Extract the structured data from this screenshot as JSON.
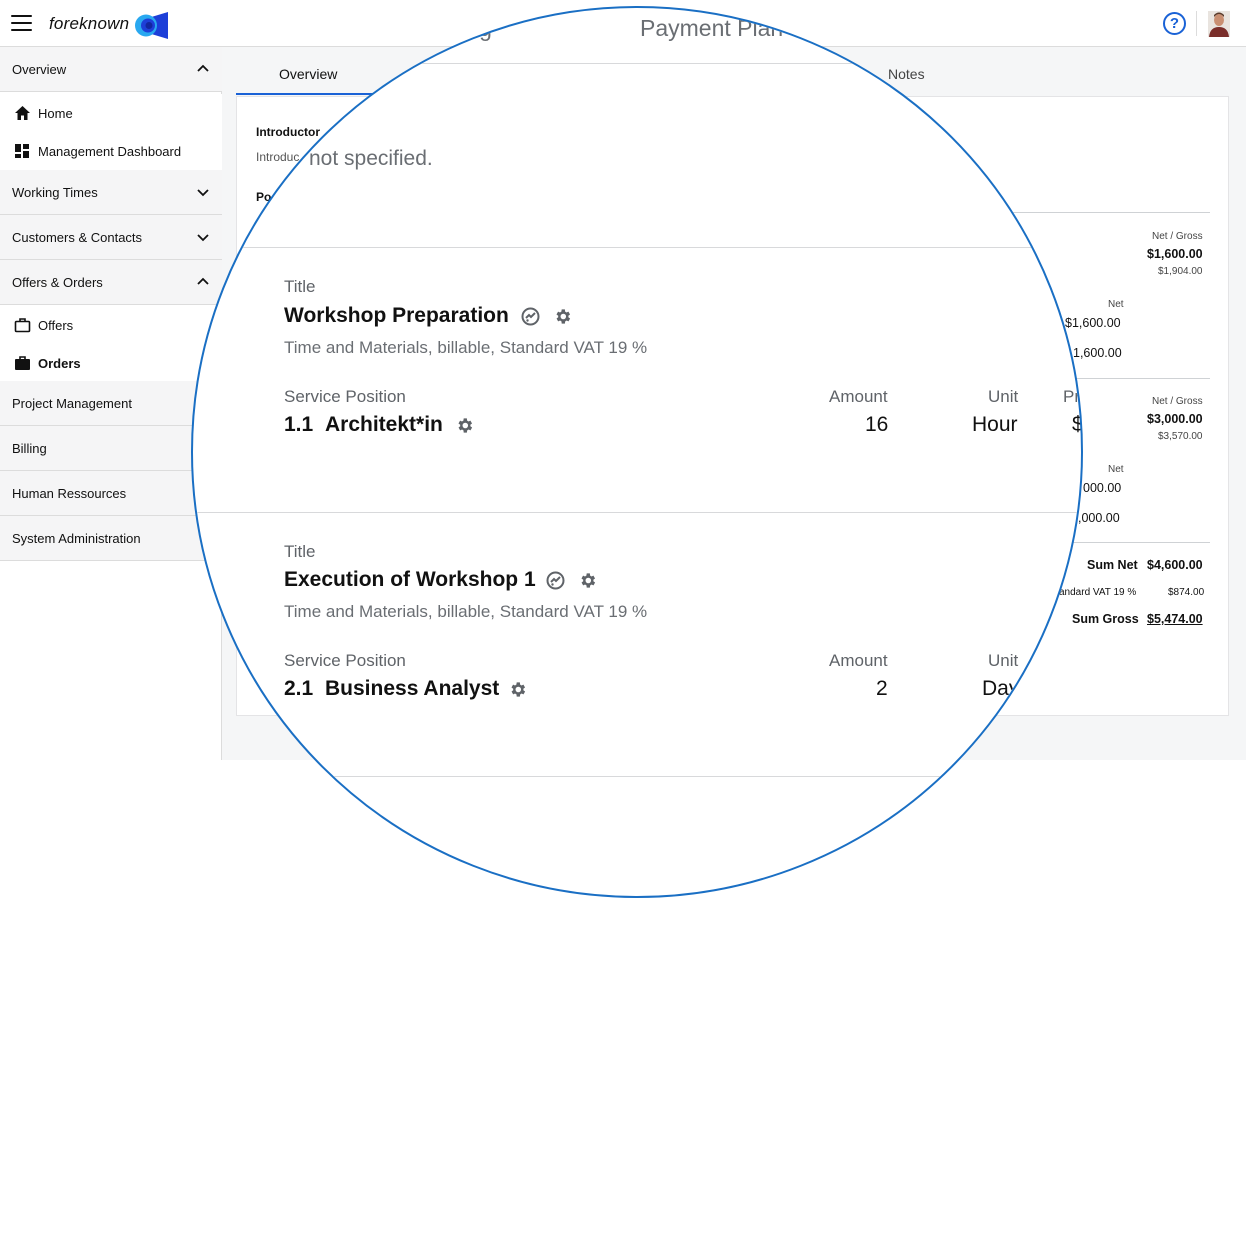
{
  "header": {
    "logo_text": "foreknown",
    "tabs_partial": [
      "lling",
      "Payment Plan"
    ],
    "help_label": "?"
  },
  "sidebar": {
    "overview": "Overview",
    "home": "Home",
    "management_dashboard": "Management Dashboard",
    "working_times": "Working Times",
    "customers_contacts": "Customers & Contacts",
    "offers_orders": "Offers & Orders",
    "offers": "Offers",
    "orders": "Orders",
    "project_management": "Project Management",
    "billing": "Billing",
    "human_ressources": "Human Ressources",
    "system_administration": "System Administration"
  },
  "content": {
    "tabs": {
      "overview": "Overview",
      "notes": "Notes"
    },
    "introductory_label": "Introductor",
    "introductory_text": "Introduc",
    "positions_label": "Po",
    "net_gross_label": "Net / Gross",
    "net_label": "Net",
    "position1": {
      "net": "$1,600.00",
      "gross": "$1,904.00",
      "sub_net": "$1,600.00",
      "sub_total": "1,600.00"
    },
    "position2": {
      "net": "$3,000.00",
      "gross": "$3,570.00",
      "sub_net": "000.00",
      "sub_total": ",000.00"
    },
    "totals": {
      "sum_net_label": "Sum Net",
      "sum_net": "$4,600.00",
      "vat_label": "andard VAT 19 %",
      "vat": "$874.00",
      "sum_gross_label": "Sum Gross",
      "sum_gross": "$5,474.00"
    }
  },
  "magnifier": {
    "tab_partial_left": "lling",
    "tab_payment_plan": "Payment Plan",
    "not_specified": "not specified.",
    "rows": [
      {
        "title_label": "Title",
        "title": "Workshop Preparation",
        "subtitle": "Time and Materials, billable, Standard VAT 19 %",
        "service_position_label": "Service Position",
        "service_number": "1.1",
        "service_name": "Architekt*in",
        "amount_label": "Amount",
        "amount": "16",
        "unit_label": "Unit",
        "unit": "Hour",
        "price_label_partial": "Pr",
        "price_partial": "$"
      },
      {
        "title_label": "Title",
        "title": "Execution of Workshop 1",
        "subtitle": "Time and Materials, billable, Standard VAT 19 %",
        "service_position_label": "Service Position",
        "service_number": "2.1",
        "service_name": "Business Analyst",
        "amount_label": "Amount",
        "amount": "2",
        "unit_label": "Unit",
        "unit": "Day"
      }
    ]
  },
  "colors": {
    "accent": "#1a62d6",
    "magnifier_border": "#1a6fc4",
    "sidebar_group_bg": "#f5f5f6",
    "content_bg": "#f5f6f7"
  },
  "icons": {
    "menu": "hamburger-icon",
    "help": "help-circle-icon",
    "home": "home-icon",
    "dashboard": "dashboard-icon",
    "offers": "briefcase-outline-icon",
    "orders": "briefcase-filled-icon",
    "chevron_up": "chevron-up-icon",
    "chevron_down": "chevron-down-icon",
    "billing_type": "billing-type-icon",
    "settings": "gear-icon"
  }
}
